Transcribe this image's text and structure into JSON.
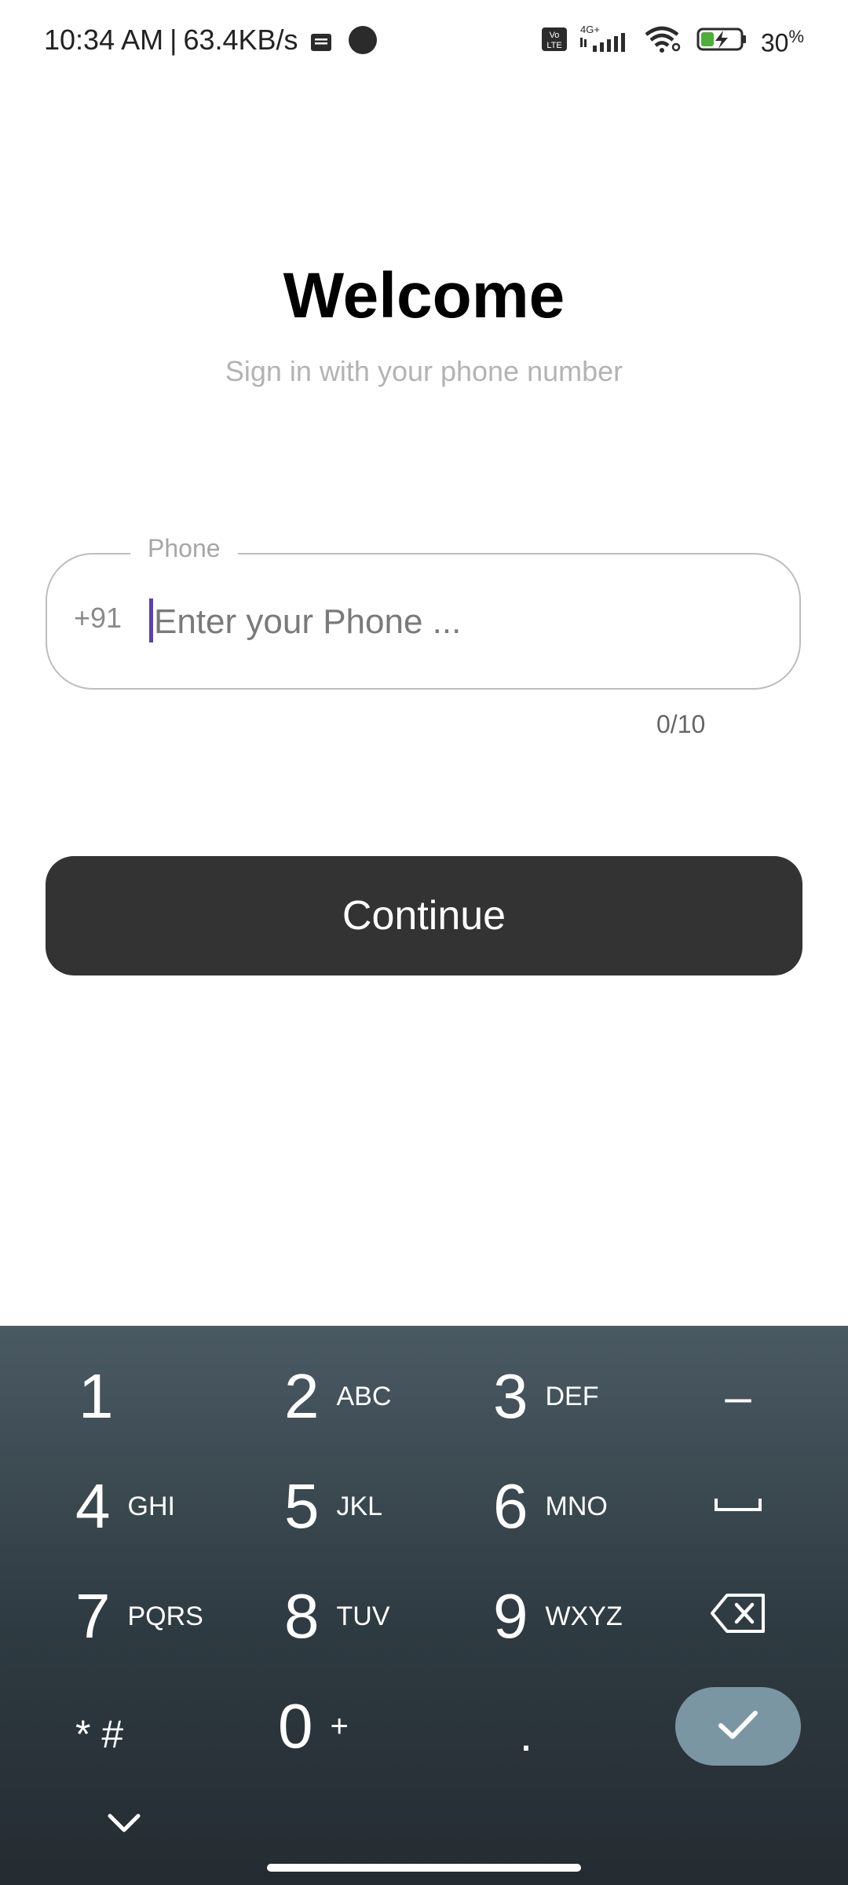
{
  "status_bar": {
    "time": "10:34 AM",
    "separator": "|",
    "speed": "63.4KB/s",
    "network_label": "4G+",
    "volte_label": "Vo LTE",
    "battery_percent": "30",
    "battery_unit": "%"
  },
  "header": {
    "title": "Welcome",
    "subtitle": "Sign in with your phone number"
  },
  "phone_field": {
    "label": "Phone",
    "country_code": "+91",
    "placeholder": "Enter your Phone ...",
    "value": "",
    "char_count": "0/10"
  },
  "continue_button": {
    "label": "Continue"
  },
  "keyboard": {
    "keys": [
      {
        "digit": "1",
        "letters": ""
      },
      {
        "digit": "2",
        "letters": "ABC"
      },
      {
        "digit": "3",
        "letters": "DEF"
      },
      {
        "digit": "4",
        "letters": "GHI"
      },
      {
        "digit": "5",
        "letters": "JKL"
      },
      {
        "digit": "6",
        "letters": "MNO"
      },
      {
        "digit": "7",
        "letters": "PQRS"
      },
      {
        "digit": "8",
        "letters": "TUV"
      },
      {
        "digit": "9",
        "letters": "WXYZ"
      },
      {
        "digit": "0",
        "letters": "+"
      }
    ],
    "dash_key": "–",
    "star_hash_key": "* #",
    "period_key": ".",
    "icons": {
      "space": "space-icon",
      "backspace": "backspace-icon",
      "done": "check-icon",
      "collapse": "chevron-down-icon"
    }
  },
  "colors": {
    "accent_caret": "#5b3fb8",
    "button_bg": "#333333",
    "done_key_bg": "#7a96a3"
  }
}
